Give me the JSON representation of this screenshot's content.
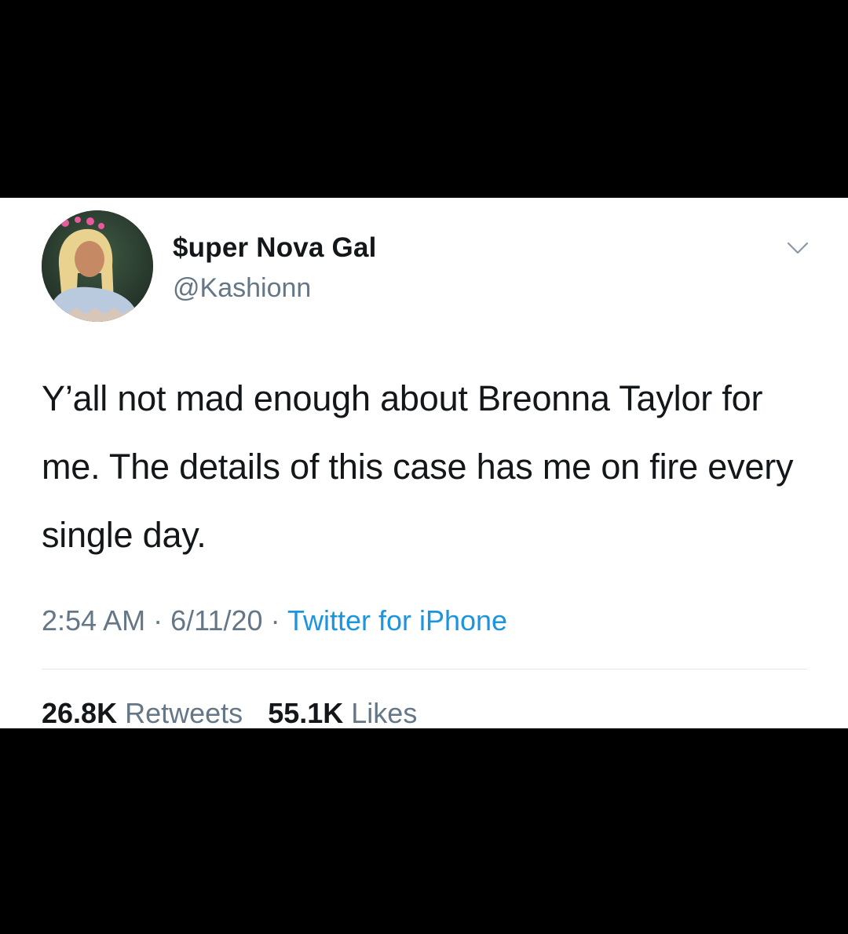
{
  "tweet": {
    "author": {
      "display_name": "$uper Nova Gal",
      "handle": "@Kashionn",
      "avatar": "profile-photo"
    },
    "menu_icon": "chevron-down-icon",
    "text": "Y’all not mad enough about Breonna Taylor for me. The details of this case has me on fire every single day.",
    "time": "2:54 AM",
    "separator": "·",
    "date": "6/11/20",
    "source": "Twitter for iPhone",
    "stats": {
      "retweets_count": "26.8K",
      "retweets_label": "Retweets",
      "likes_count": "55.1K",
      "likes_label": "Likes"
    }
  },
  "colors": {
    "background": "#000000",
    "card": "#ffffff",
    "primary_text": "#14171a",
    "secondary_text": "#657786",
    "link": "#1b95e0",
    "divider": "#e1e8ed"
  }
}
